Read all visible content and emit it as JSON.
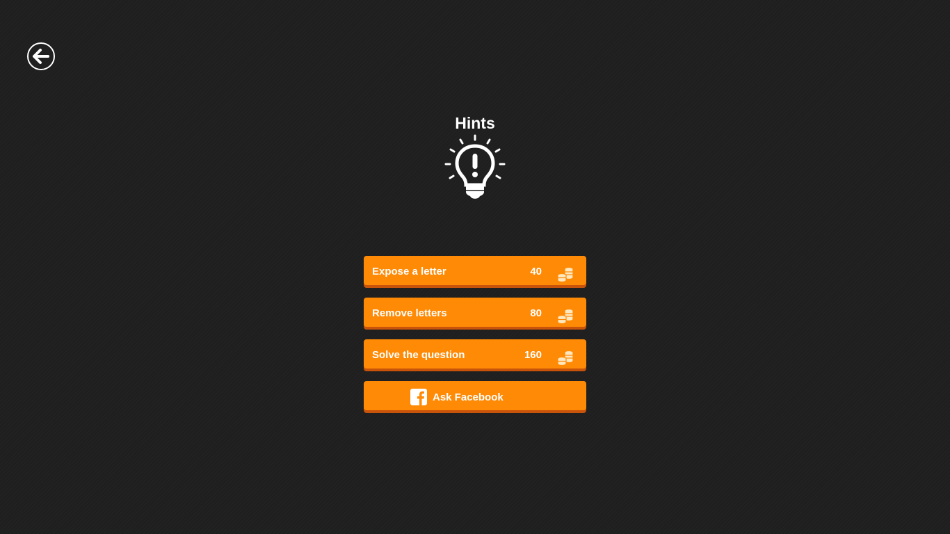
{
  "header": {
    "back_icon": "back-arrow-icon",
    "title": "Hints",
    "title_icon": "lightbulb-exclamation-icon"
  },
  "hints": [
    {
      "label": "Expose a letter",
      "cost": "40",
      "icon": "coins-icon"
    },
    {
      "label": "Remove letters",
      "cost": "80",
      "icon": "coins-icon"
    },
    {
      "label": "Solve the question",
      "cost": "160",
      "icon": "coins-icon"
    }
  ],
  "facebook": {
    "label": "Ask Facebook",
    "icon": "facebook-icon"
  },
  "colors": {
    "background": "#1f1f1f",
    "button": "#ff8a05",
    "button_shadow": "#c7540a",
    "text": "#ffffff"
  }
}
